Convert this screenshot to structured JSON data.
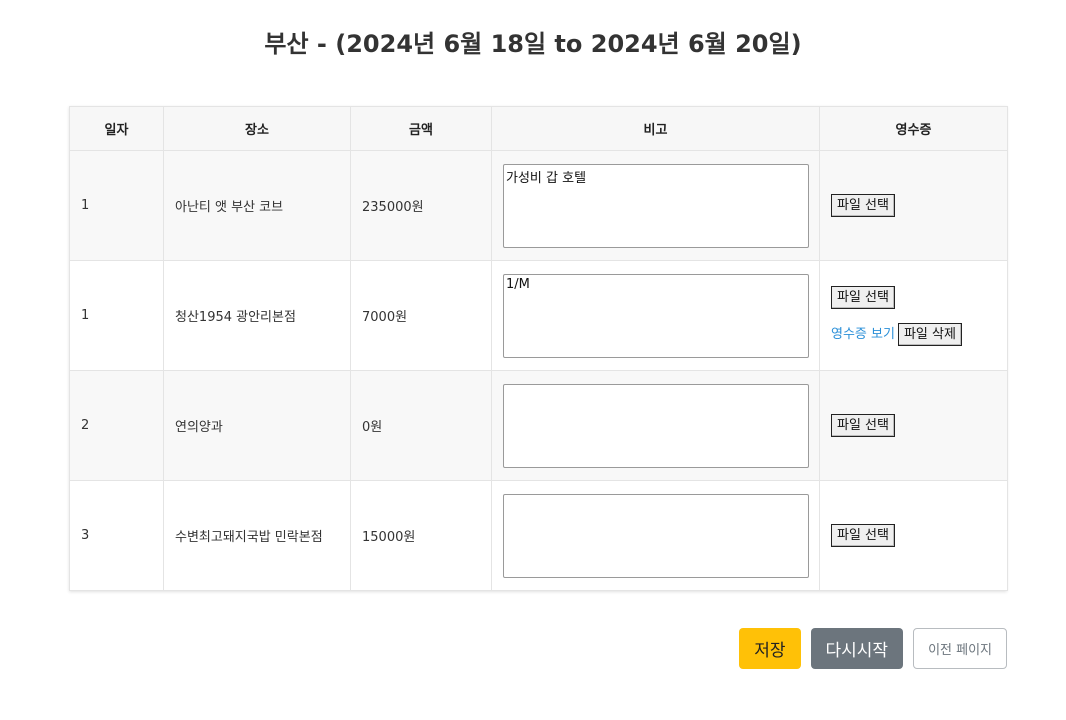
{
  "page": {
    "title": "부산 - (2024년 6월 18일 to 2024년 6월 20일)"
  },
  "table": {
    "headers": {
      "day": "일자",
      "place": "장소",
      "amount": "금액",
      "memo": "비고",
      "receipt": "영수증"
    },
    "rows": [
      {
        "day": "1",
        "place": "아난티 앳 부산 코브",
        "amount": "235000원",
        "memo": "가성비 갑 호텔",
        "file_button": "파일 선택"
      },
      {
        "day": "1",
        "place": "청산1954 광안리본점",
        "amount": "7000원",
        "memo": "1/M",
        "file_button": "파일 선택",
        "view_link": "영수증 보기",
        "delete_button": "파일 삭제"
      },
      {
        "day": "2",
        "place": "연의양과",
        "amount": "0원",
        "memo": "",
        "file_button": "파일 선택"
      },
      {
        "day": "3",
        "place": "수변최고돼지국밥 민락본점",
        "amount": "15000원",
        "memo": "",
        "file_button": "파일 선택"
      }
    ]
  },
  "footer": {
    "save": "저장",
    "restart": "다시시작",
    "prev": "이전 페이지"
  },
  "colors": {
    "save": "#ffc107",
    "restart": "#6c757d",
    "link": "#2a8fd8"
  }
}
